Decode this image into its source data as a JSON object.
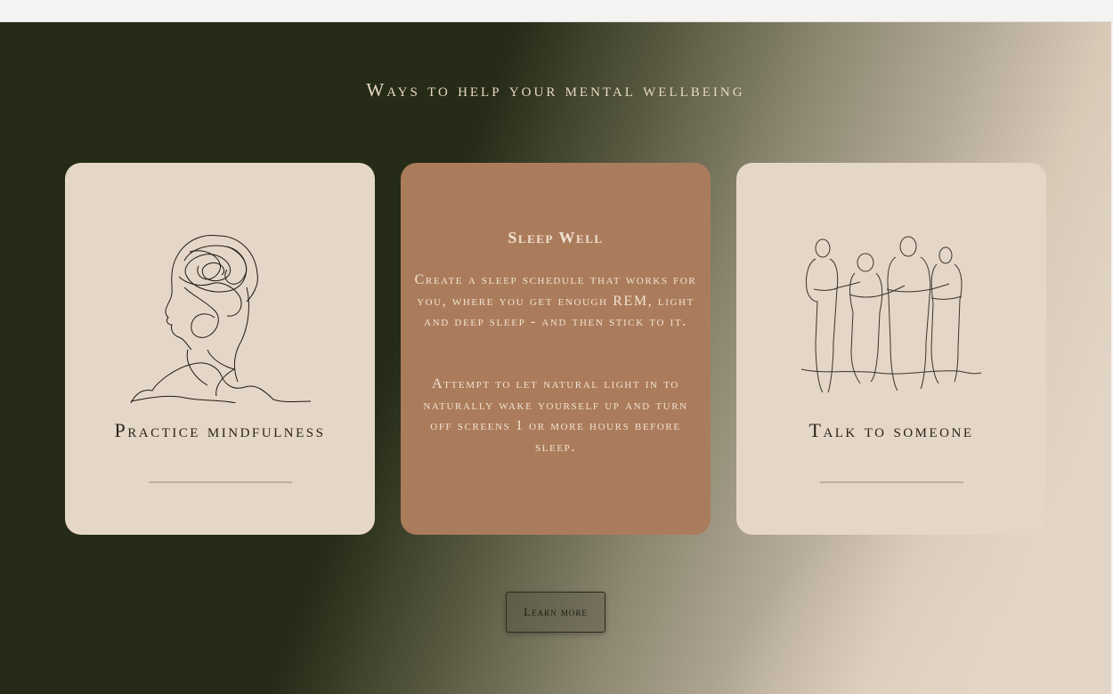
{
  "section": {
    "heading": "Ways to help your mental wellbeing"
  },
  "cards": [
    {
      "title": "Practice mindfulness",
      "illustration": "head-line-drawing-icon"
    },
    {
      "title": "Sleep Well",
      "paragraphs": [
        "Create a sleep schedule that works for you, where you get enough REM, light and deep sleep - and then stick to it.",
        "Attempt to let natural light in to naturally wake yourself up and turn off screens 1 or more hours before sleep."
      ]
    },
    {
      "title": "Talk to someone",
      "illustration": "group-of-people-line-drawing-icon"
    }
  ],
  "button": {
    "label": "Learn more"
  },
  "colors": {
    "dark_green": "#252b17",
    "beige": "#e5d7c7",
    "terracotta": "#ab7c5c",
    "heading_text": "#e6d7c2"
  }
}
